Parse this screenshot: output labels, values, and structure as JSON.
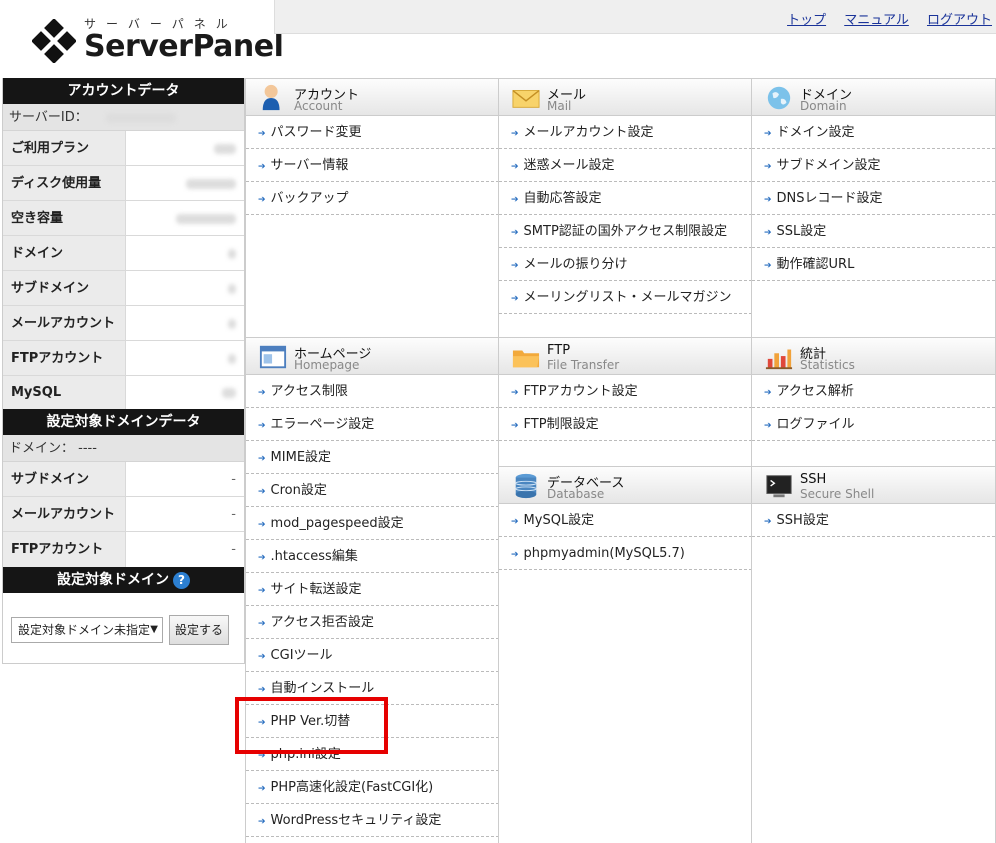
{
  "header": {
    "logo_kana": "サーバーパネル",
    "logo_name": "ServerPanel",
    "links": [
      "トップ",
      "マニュアル",
      "ログアウト"
    ]
  },
  "sidebar": {
    "account_title": "アカウントデータ",
    "server_id_label": "サーバーID：",
    "account_rows": [
      {
        "key": "ご利用プラン"
      },
      {
        "key": "ディスク使用量"
      },
      {
        "key": "空き容量"
      },
      {
        "key": "ドメイン"
      },
      {
        "key": "サブドメイン"
      },
      {
        "key": "メールアカウント"
      },
      {
        "key": "FTPアカウント"
      },
      {
        "key": "MySQL"
      }
    ],
    "domain_data_title": "設定対象ドメインデータ",
    "domain_label": "ドメイン：",
    "domain_value": "----",
    "domain_rows": [
      {
        "key": "サブドメイン",
        "value": "-"
      },
      {
        "key": "メールアカウント",
        "value": "-"
      },
      {
        "key": "FTPアカウント",
        "value": "-"
      }
    ],
    "target_domain_title": "設定対象ドメイン",
    "help_icon": "?",
    "select_value": "設定対象ドメイン未指定",
    "select_button": "設定する"
  },
  "categories": {
    "account": {
      "ja": "アカウント",
      "en": "Account",
      "items": [
        "パスワード変更",
        "サーバー情報",
        "バックアップ"
      ]
    },
    "mail": {
      "ja": "メール",
      "en": "Mail",
      "items": [
        "メールアカウント設定",
        "迷惑メール設定",
        "自動応答設定",
        "SMTP認証の国外アクセス制限設定",
        "メールの振り分け",
        "メーリングリスト・メールマガジン"
      ]
    },
    "domain": {
      "ja": "ドメイン",
      "en": "Domain",
      "items": [
        "ドメイン設定",
        "サブドメイン設定",
        "DNSレコード設定",
        "SSL設定",
        "動作確認URL"
      ]
    },
    "homepage": {
      "ja": "ホームページ",
      "en": "Homepage",
      "items": [
        "アクセス制限",
        "エラーページ設定",
        "MIME設定",
        "Cron設定",
        "mod_pagespeed設定",
        ".htaccess編集",
        "サイト転送設定",
        "アクセス拒否設定",
        "CGIツール",
        "自動インストール",
        "PHP Ver.切替",
        "php.ini設定",
        "PHP高速化設定(FastCGI化)",
        "WordPressセキュリティ設定"
      ]
    },
    "ftp": {
      "ja": "FTP",
      "en": "File Transfer",
      "items": [
        "FTPアカウント設定",
        "FTP制限設定"
      ]
    },
    "stats": {
      "ja": "統計",
      "en": "Statistics",
      "items": [
        "アクセス解析",
        "ログファイル"
      ]
    },
    "database": {
      "ja": "データベース",
      "en": "Database",
      "items": [
        "MySQL設定",
        "phpmyadmin(MySQL5.7)"
      ]
    },
    "ssh": {
      "ja": "SSH",
      "en": "Secure Shell",
      "items": [
        "SSH設定"
      ]
    }
  },
  "highlight_color": "#e60000",
  "link_color": "#1a3399"
}
